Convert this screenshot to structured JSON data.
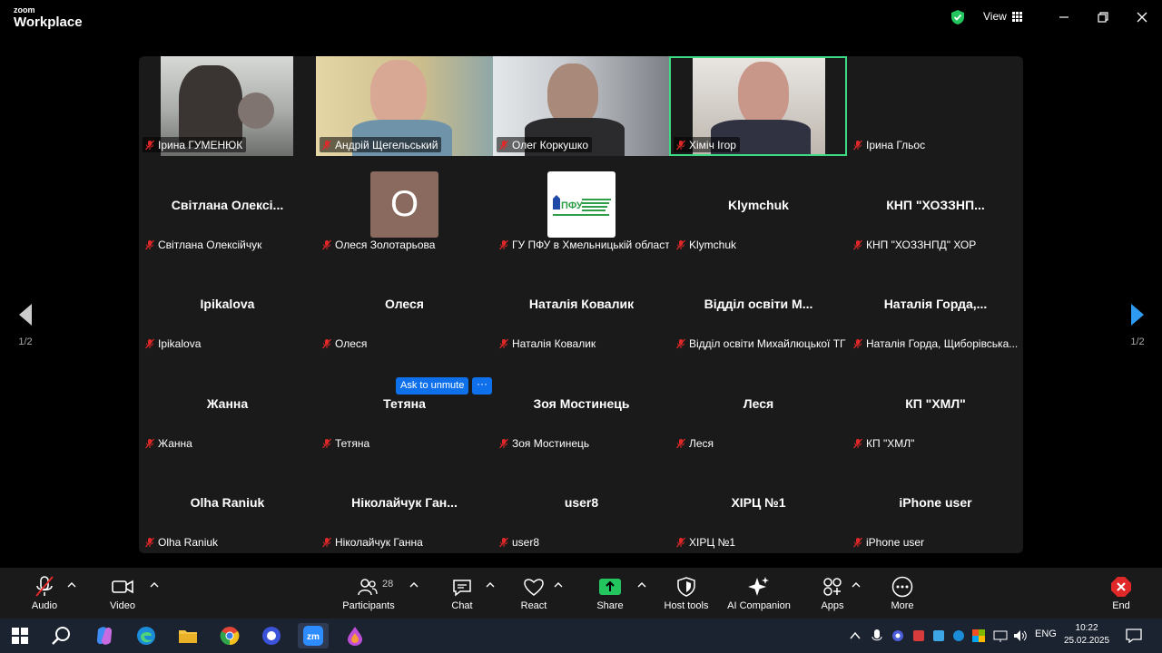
{
  "app": {
    "brand_small": "zoom",
    "brand_big": "Workplace",
    "view_label": "View"
  },
  "pager": {
    "left": "1/2",
    "right": "1/2"
  },
  "tiles": [
    {
      "label": "Ірина ГУМЕНЮК",
      "display": "",
      "video": true
    },
    {
      "label": "Андрій Щегельський",
      "display": "",
      "video": true
    },
    {
      "label": "Олег Коркушко",
      "display": "",
      "video": true
    },
    {
      "label": "Хіміч Ігор",
      "display": "",
      "video": true,
      "speaking": true
    },
    {
      "label": "Ірина Гльос",
      "display": ""
    },
    {
      "label": "Світлана Олексійчук",
      "display": "Світлана  Олексі..."
    },
    {
      "label": "Олеся Золотарьова",
      "display": "",
      "avatar_letter": "О"
    },
    {
      "label": "ГУ ПФУ в Хмельницькій області",
      "display": "",
      "logo": "ПФУ"
    },
    {
      "label": "Klymchuk",
      "display": "Klymchuk"
    },
    {
      "label": "КНП \"ХОЗЗНПД\" ХОР",
      "display": "КНП  \"ХОЗЗНП..."
    },
    {
      "label": "Ipikalova",
      "display": "Ipikalova"
    },
    {
      "label": "Олеся",
      "display": "Олеся"
    },
    {
      "label": "Наталія Ковалик",
      "display": "Наталія Ковалик"
    },
    {
      "label": "Відділ освіти Михайлюцької ТГ",
      "display": "Відділ освіти М..."
    },
    {
      "label": "Наталія Горда, Щиборівська...",
      "display": "Наталія  Горда,..."
    },
    {
      "label": "Жанна",
      "display": "Жанна"
    },
    {
      "label": "Тетяна",
      "display": "Тетяна"
    },
    {
      "label": "Зоя Мостинець",
      "display": "Зоя Мостинець"
    },
    {
      "label": "Леся",
      "display": "Леся"
    },
    {
      "label": "КП \"ХМЛ\"",
      "display": "КП  \"ХМЛ\""
    },
    {
      "label": "Olha Raniuk",
      "display": "Olha Raniuk"
    },
    {
      "label": "Ніколайчук Ганна",
      "display": "Ніколайчук  Ган..."
    },
    {
      "label": "user8",
      "display": "user8"
    },
    {
      "label": "ХІРЦ №1",
      "display": "ХІРЦ №1"
    },
    {
      "label": "iPhone user",
      "display": "iPhone user"
    }
  ],
  "hover": {
    "ask_unmute": "Ask to unmute",
    "more": "···"
  },
  "toolbar": {
    "audio": "Audio",
    "video": "Video",
    "participants": "Participants",
    "participants_count": "28",
    "chat": "Chat",
    "react": "React",
    "share": "Share",
    "host_tools": "Host tools",
    "ai_companion": "AI Companion",
    "apps": "Apps",
    "more": "More",
    "end": "End"
  },
  "taskbar": {
    "lang": "ENG",
    "time": "10:22",
    "date": "25.02.2025"
  },
  "colors": {
    "speaking": "#3ddc84",
    "share": "#22c55e",
    "end": "#e02828",
    "accent": "#0e71eb"
  }
}
